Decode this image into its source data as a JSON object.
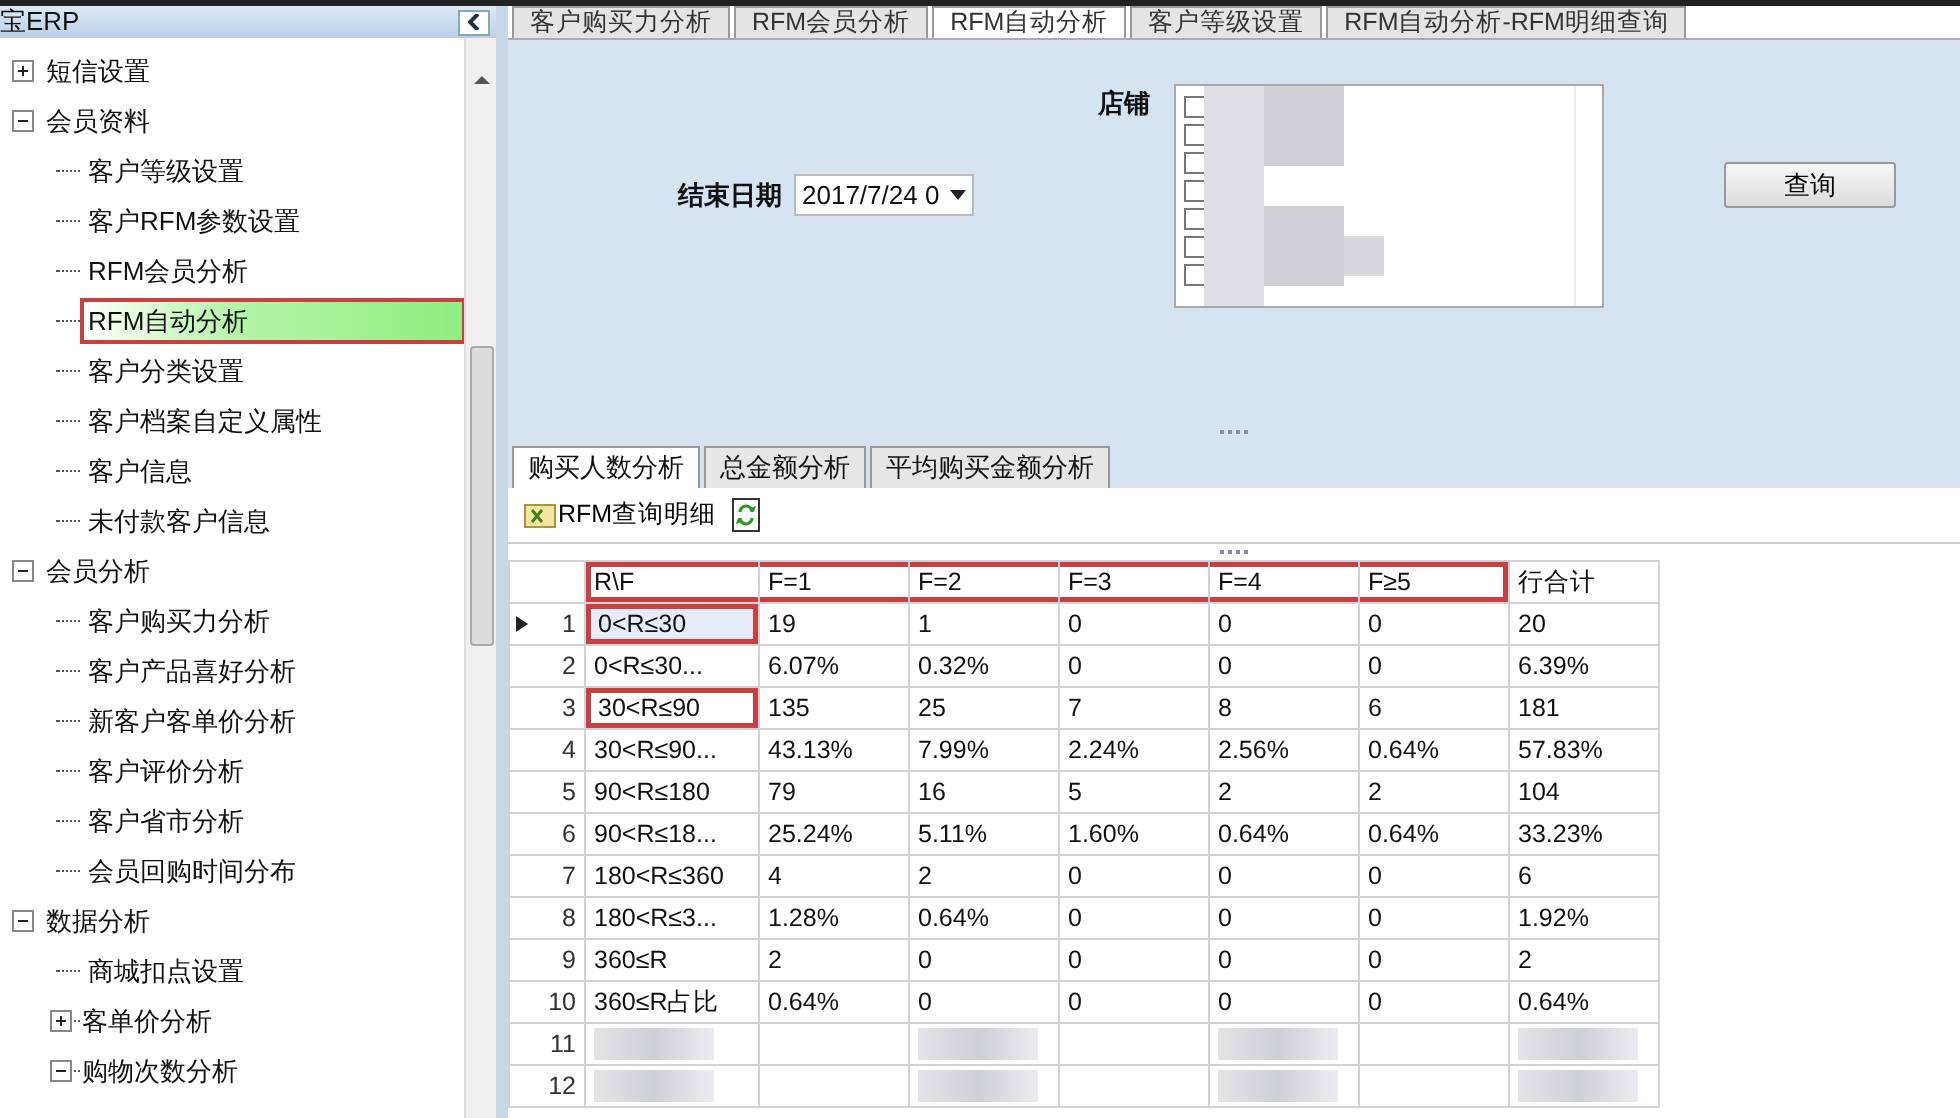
{
  "sidebar": {
    "title": "宝ERP",
    "tree": [
      {
        "label": "短信设置",
        "expanded": false,
        "selected": false,
        "annotated": false
      },
      {
        "label": "会员资料",
        "expanded": true,
        "selected": false,
        "annotated": false,
        "children": [
          {
            "label": "客户等级设置",
            "selected": false,
            "annotated": false
          },
          {
            "label": "客户RFM参数设置",
            "selected": false,
            "annotated": false
          },
          {
            "label": "RFM会员分析",
            "selected": false,
            "annotated": false
          },
          {
            "label": "RFM自动分析",
            "selected": true,
            "annotated": true
          },
          {
            "label": "客户分类设置",
            "selected": false,
            "annotated": false
          },
          {
            "label": "客户档案自定义属性",
            "selected": false,
            "annotated": false
          },
          {
            "label": "客户信息",
            "selected": false,
            "annotated": false
          },
          {
            "label": "未付款客户信息",
            "selected": false,
            "annotated": false
          }
        ]
      },
      {
        "label": "会员分析",
        "expanded": true,
        "selected": false,
        "annotated": false,
        "children": [
          {
            "label": "客户购买力分析",
            "selected": false,
            "annotated": false
          },
          {
            "label": "客户产品喜好分析",
            "selected": false,
            "annotated": false
          },
          {
            "label": "新客户客单价分析",
            "selected": false,
            "annotated": false
          },
          {
            "label": "客户评价分析",
            "selected": false,
            "annotated": false
          },
          {
            "label": "客户省市分析",
            "selected": false,
            "annotated": false
          },
          {
            "label": "会员回购时间分布",
            "selected": false,
            "annotated": false
          }
        ]
      },
      {
        "label": "数据分析",
        "expanded": true,
        "selected": false,
        "annotated": false,
        "children": [
          {
            "label": "商城扣点设置",
            "selected": false,
            "annotated": false
          },
          {
            "label": "客单价分析",
            "expanded": false,
            "selected": false,
            "annotated": false
          },
          {
            "label": "购物次数分析",
            "expanded": true,
            "selected": false,
            "annotated": false
          }
        ]
      }
    ]
  },
  "tabs": [
    {
      "label": "客户购买力分析",
      "selected": false
    },
    {
      "label": "RFM会员分析",
      "selected": false
    },
    {
      "label": "RFM自动分析",
      "selected": true
    },
    {
      "label": "客户等级设置",
      "selected": false
    },
    {
      "label": "RFM自动分析-RFM明细查询",
      "selected": false
    }
  ],
  "form": {
    "end_date_label": "结束日期",
    "end_date_value": "2017/7/24 0",
    "store_label": "店铺",
    "stores": [
      {
        "checked": false
      },
      {
        "checked": false
      },
      {
        "checked": false
      },
      {
        "checked": false
      },
      {
        "checked": false
      },
      {
        "checked": false
      },
      {
        "checked": false
      }
    ],
    "query_button": "查询"
  },
  "sub_tabs": [
    {
      "label": "购买人数分析",
      "selected": true
    },
    {
      "label": "总金额分析",
      "selected": false
    },
    {
      "label": "平均购买金额分析",
      "selected": false
    }
  ],
  "toolbar": {
    "detail_button": "RFM查询明细"
  },
  "table": {
    "header_annotated": true,
    "columns": [
      "R\\F",
      "F=1",
      "F=2",
      "F=3",
      "F=4",
      "F≥5",
      "行合计"
    ],
    "rows": [
      {
        "number": "1",
        "current": true,
        "annotated": true,
        "cells": [
          "0<R≤30",
          "19",
          "1",
          "0",
          "0",
          "0",
          "20"
        ]
      },
      {
        "number": "2",
        "current": false,
        "annotated": false,
        "cells": [
          "0<R≤30...",
          "6.07%",
          "0.32%",
          "0",
          "0",
          "0",
          "6.39%"
        ]
      },
      {
        "number": "3",
        "current": false,
        "annotated": true,
        "cells": [
          "30<R≤90",
          "135",
          "25",
          "7",
          "8",
          "6",
          "181"
        ]
      },
      {
        "number": "4",
        "current": false,
        "annotated": false,
        "cells": [
          "30<R≤90...",
          "43.13%",
          "7.99%",
          "2.24%",
          "2.56%",
          "0.64%",
          "57.83%"
        ]
      },
      {
        "number": "5",
        "current": false,
        "annotated": false,
        "cells": [
          "90<R≤180",
          "79",
          "16",
          "5",
          "2",
          "2",
          "104"
        ]
      },
      {
        "number": "6",
        "current": false,
        "annotated": false,
        "cells": [
          "90<R≤18...",
          "25.24%",
          "5.11%",
          "1.60%",
          "0.64%",
          "0.64%",
          "33.23%"
        ]
      },
      {
        "number": "7",
        "current": false,
        "annotated": false,
        "cells": [
          "180<R≤360",
          "4",
          "2",
          "0",
          "0",
          "0",
          "6"
        ]
      },
      {
        "number": "8",
        "current": false,
        "annotated": false,
        "cells": [
          "180<R≤3...",
          "1.28%",
          "0.64%",
          "0",
          "0",
          "0",
          "1.92%"
        ]
      },
      {
        "number": "9",
        "current": false,
        "annotated": false,
        "cells": [
          "360≤R",
          "2",
          "0",
          "0",
          "0",
          "0",
          "2"
        ]
      },
      {
        "number": "10",
        "current": false,
        "annotated": false,
        "cells": [
          "360≤R占比",
          "0.64%",
          "0",
          "0",
          "0",
          "0",
          "0.64%"
        ]
      },
      {
        "number": "11",
        "current": false,
        "annotated": false,
        "redacted": true
      },
      {
        "number": "12",
        "current": false,
        "annotated": false,
        "redacted": true
      }
    ]
  }
}
